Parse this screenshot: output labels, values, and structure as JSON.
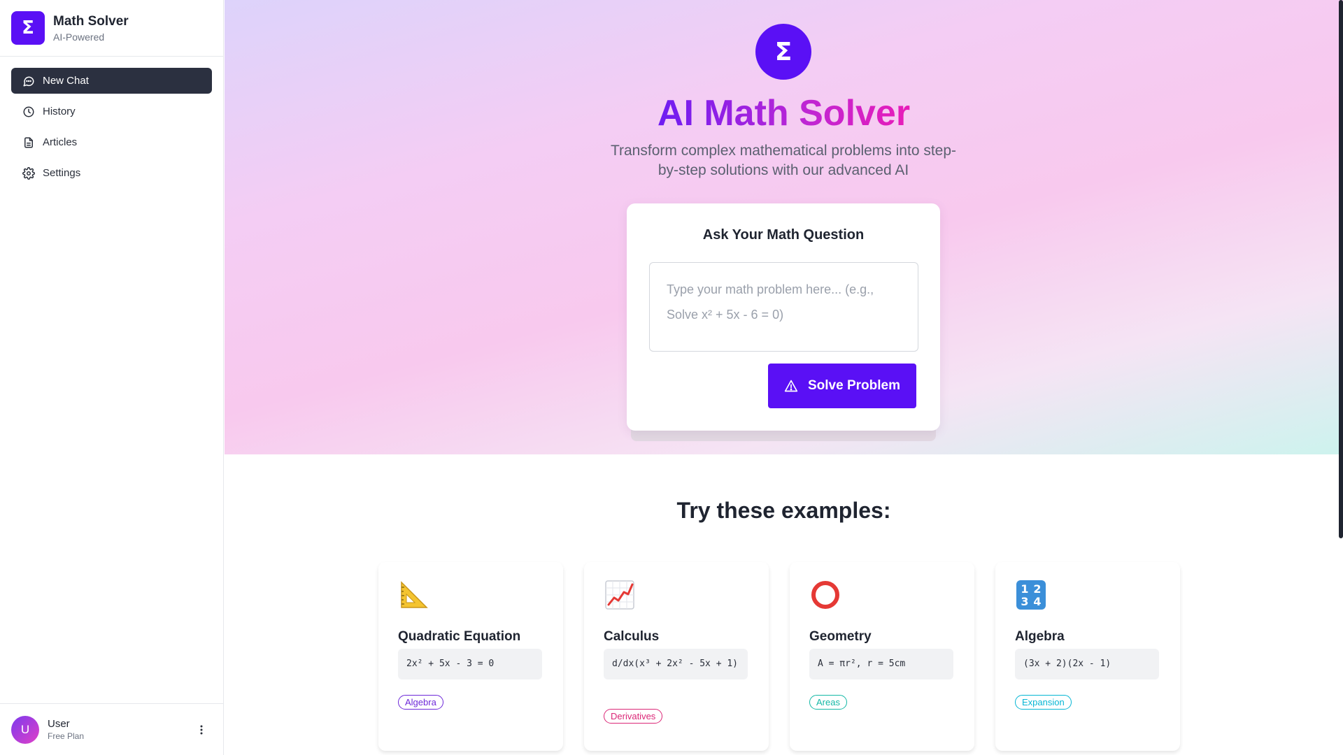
{
  "sidebar": {
    "brand": {
      "logo_symbol": "Σ",
      "name": "Math Solver",
      "subtitle": "AI-Powered"
    },
    "nav": [
      {
        "label": "New Chat",
        "icon": "chat-bubble-icon",
        "active": true
      },
      {
        "label": "History",
        "icon": "clock-icon",
        "active": false
      },
      {
        "label": "Articles",
        "icon": "document-icon",
        "active": false
      },
      {
        "label": "Settings",
        "icon": "gear-icon",
        "active": false
      }
    ],
    "user": {
      "initial": "U",
      "name": "User",
      "plan": "Free Plan",
      "menu_icon": "vertical-dots-icon"
    }
  },
  "hero": {
    "logo_symbol": "Σ",
    "title": "AI Math Solver",
    "subtitle": "Transform complex mathematical problems into step-by-step solutions with our advanced AI"
  },
  "ask": {
    "title": "Ask Your Math Question",
    "input_value": "",
    "input_placeholder": "Type your math problem here... (e.g., Solve x² + 5x - 6 = 0)",
    "solve_label": "Solve Problem",
    "solve_icon": "warning-triangle-icon"
  },
  "examples": {
    "title": "Try these examples:",
    "items": [
      {
        "icon": "triangular-ruler-icon",
        "title": "Quadratic Equation",
        "expression": "2x² + 5x - 3 = 0",
        "tag": "Algebra",
        "tag_color": "#6d28d9"
      },
      {
        "icon": "chart-increasing-icon",
        "title": "Calculus",
        "expression": "d/dx(x³ + 2x² - 5x + 1)",
        "tag": "Derivatives",
        "tag_color": "#db2777"
      },
      {
        "icon": "red-circle-icon",
        "title": "Geometry",
        "expression": "A = πr², r = 5cm",
        "tag": "Areas",
        "tag_color": "#14b8a6"
      },
      {
        "icon": "numbers-1234-icon",
        "title": "Algebra",
        "expression": "(3x + 2)(2x - 1)",
        "tag": "Expansion",
        "tag_color": "#06b6d4"
      }
    ]
  },
  "colors": {
    "brand_purple": "#5a10f5",
    "sidebar_active": "#2b3040",
    "title_gradient_start": "#6d1cf2",
    "title_gradient_end": "#e81cb8"
  }
}
